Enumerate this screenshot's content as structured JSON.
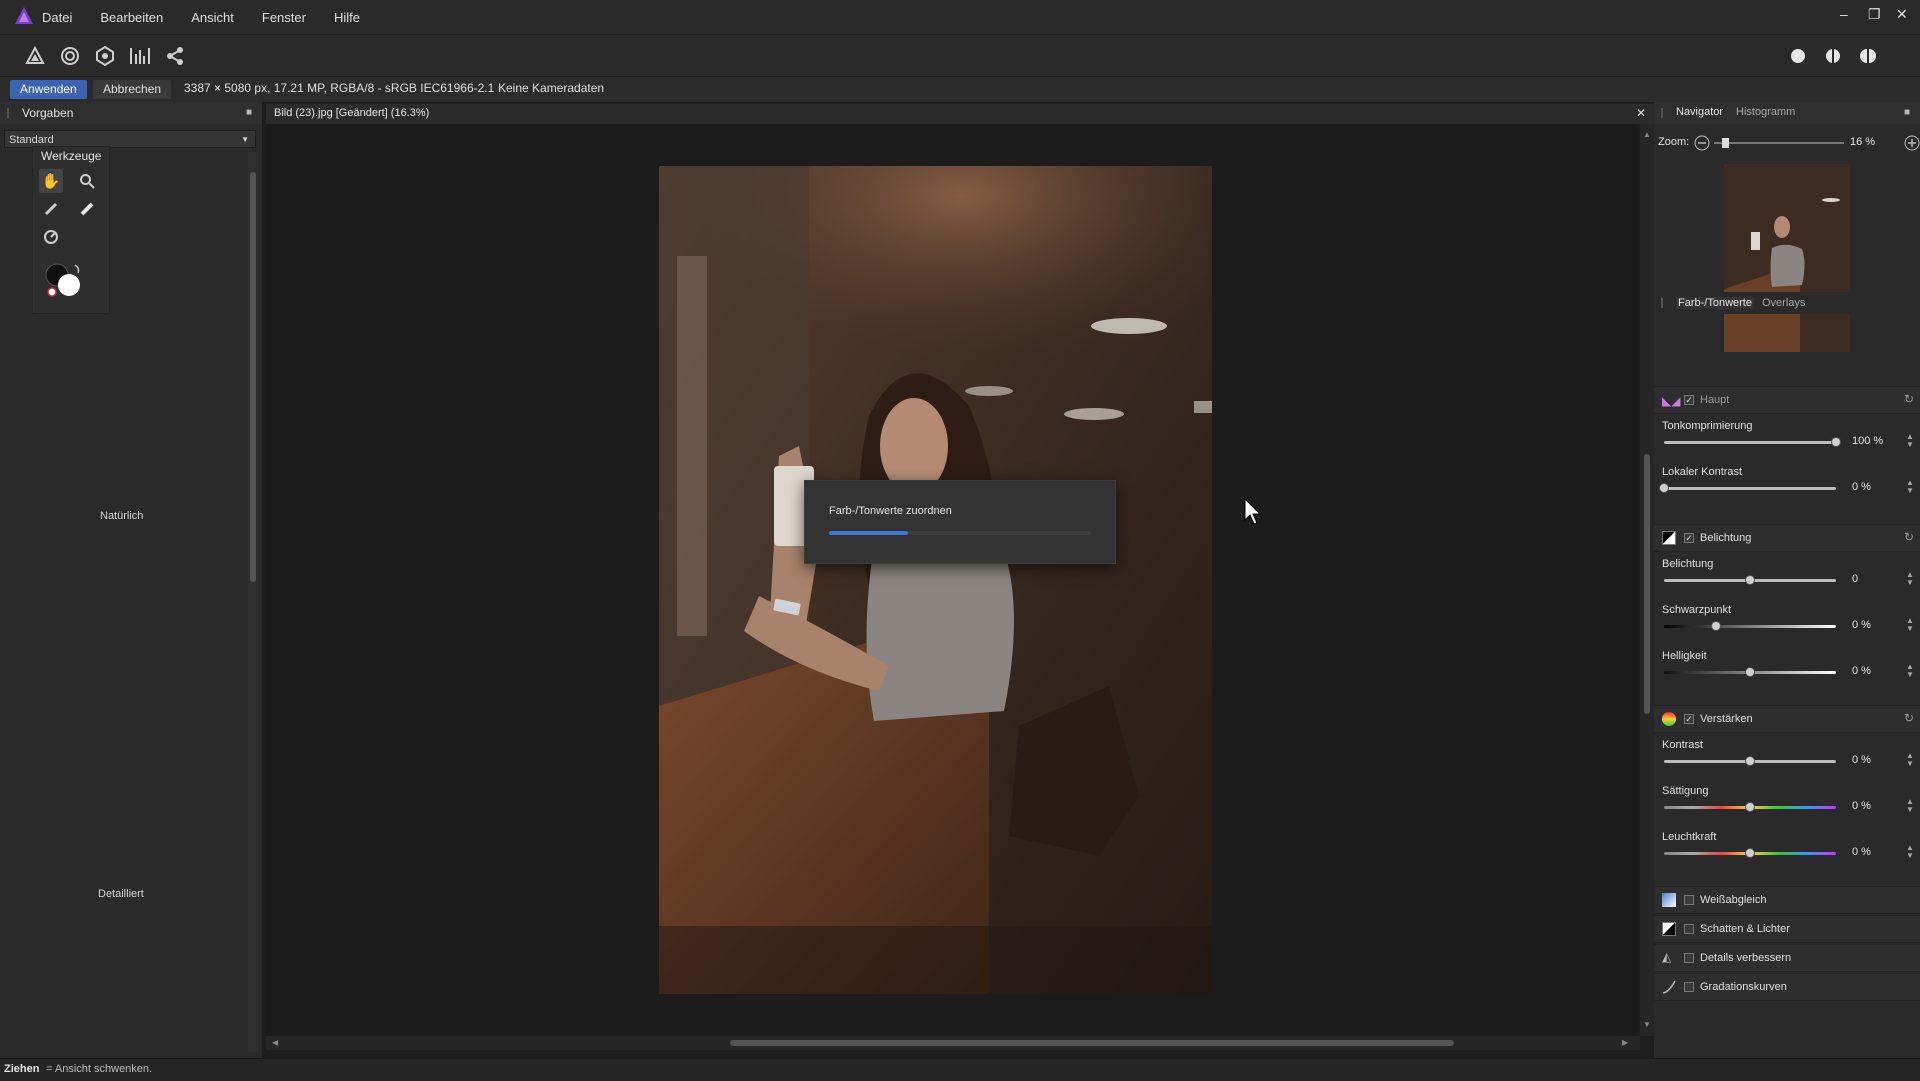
{
  "menubar": {
    "items": [
      "Datei",
      "Bearbeiten",
      "Ansicht",
      "Fenster",
      "Hilfe"
    ],
    "window_controls": [
      "–",
      "❐",
      "✕"
    ]
  },
  "toolbar": {
    "persona_icons": [
      "develop-persona-icon",
      "tone-mapping-persona-icon",
      "export-persona-icon",
      "histogram-icon",
      "share-icon"
    ],
    "view_icons": [
      "single-view-icon",
      "split-view-icon",
      "mirrored-view-icon"
    ]
  },
  "context": {
    "apply_label": "Anwenden",
    "cancel_label": "Abbrechen",
    "image_info": "3387 × 5080 px, 17.21 MP, RGBA/8 - sRGB IEC61966-2.1",
    "camera_info": "Keine Kameradaten"
  },
  "left_panel": {
    "tab": "Vorgaben",
    "preset_select": "Standard",
    "tools_title": "Werkzeuge",
    "preset_natural": "Natürlich",
    "preset_detailed": "Detailliert"
  },
  "document": {
    "title": "Bild (23).jpg [Geändert] (16.3%)",
    "close": "✕"
  },
  "dialog": {
    "title": "Farb-/Tonwerte zuordnen",
    "progress": 0.3
  },
  "navigator": {
    "tabs": [
      "Navigator",
      "Histogramm"
    ],
    "zoom_label": "Zoom:",
    "zoom_value": "16 %",
    "zoom_fraction": 0.06
  },
  "adjust": {
    "tabs": [
      "Farb-/Tonwerte",
      "Overlays"
    ],
    "main_label": "Haupt",
    "sliders": [
      {
        "label": "Tonkomprimierung",
        "value": "100 %",
        "pos": 1.0
      },
      {
        "label": "Lokaler Kontrast",
        "value": "0 %",
        "pos": 0.0
      }
    ],
    "exposure_section": "Belichtung",
    "exposure_sliders": [
      {
        "label": "Belichtung",
        "value": "0",
        "pos": 0.5
      },
      {
        "label": "Schwarzpunkt",
        "value": "0 %",
        "pos": 0.3
      },
      {
        "label": "Helligkeit",
        "value": "0 %",
        "pos": 0.5
      }
    ],
    "enhance_section": "Verstärken",
    "enhance_sliders": [
      {
        "label": "Kontrast",
        "value": "0 %",
        "pos": 0.5
      },
      {
        "label": "Sättigung",
        "value": "0 %",
        "pos": 0.5
      },
      {
        "label": "Leuchtkraft",
        "value": "0 %",
        "pos": 0.5
      }
    ],
    "collapsed_sections": [
      "Weißabgleich",
      "Schatten & Lichter",
      "Details verbessern",
      "Gradationskurven"
    ]
  },
  "status": {
    "bold": "Ziehen",
    "rest": " = Ansicht schwenken."
  }
}
